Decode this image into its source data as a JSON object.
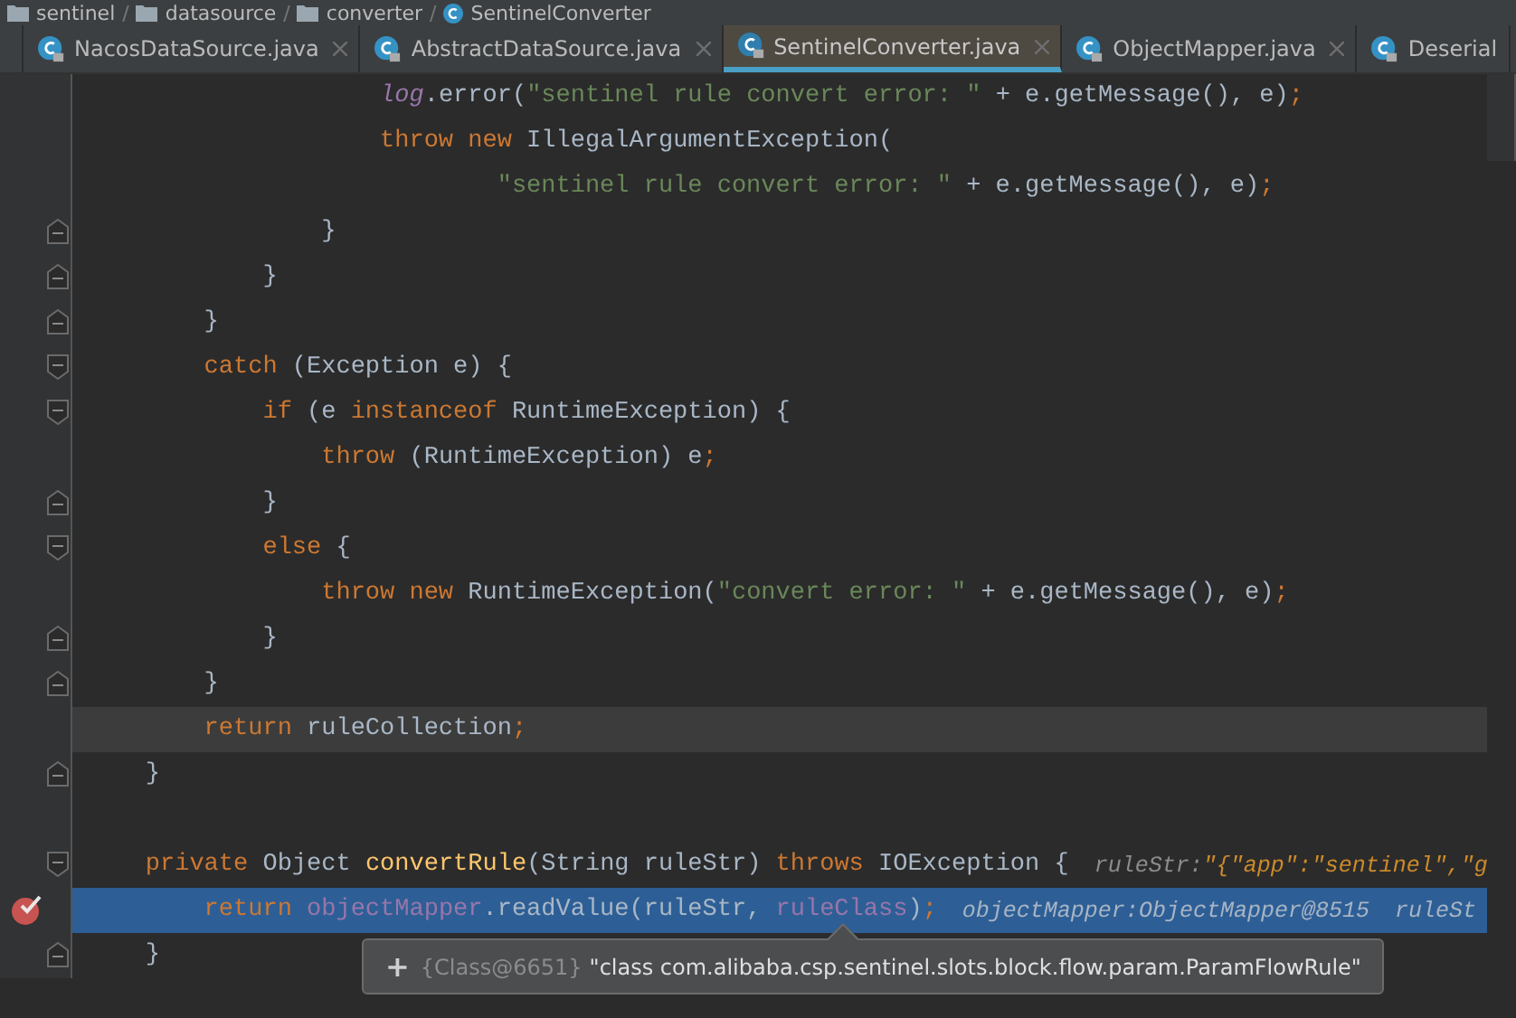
{
  "breadcrumbs": [
    {
      "label": "sentinel",
      "kind": "module",
      "separator": "/"
    },
    {
      "label": "datasource",
      "kind": "folder",
      "separator": "/"
    },
    {
      "label": "converter",
      "kind": "folder",
      "separator": "/"
    },
    {
      "label": "SentinelConverter",
      "kind": "class"
    }
  ],
  "tabs": [
    {
      "label": "NacosDataSource.java",
      "selected": false
    },
    {
      "label": "AbstractDataSource.java",
      "selected": false
    },
    {
      "label": "SentinelConverter.java",
      "selected": true
    },
    {
      "label": "ObjectMapper.java",
      "selected": false
    },
    {
      "label": "Deserial",
      "selected": false
    }
  ],
  "lines": [
    {
      "current": false,
      "selected": false,
      "breakpoint": false,
      "tokens": [
        {
          "kind": "static",
          "text": "                    log"
        },
        {
          "kind": "plain",
          "text": ".error("
        },
        {
          "kind": "string",
          "text": "\"sentinel rule convert error: \""
        },
        {
          "kind": "plain",
          "text": " + e.getMessage(), e)"
        },
        {
          "kind": "punct",
          "text": ";"
        }
      ]
    },
    {
      "current": false,
      "selected": false,
      "breakpoint": false,
      "tokens": [
        {
          "kind": "keyword",
          "text": "                    throw new"
        },
        {
          "kind": "plain",
          "text": " IllegalArgumentException("
        }
      ]
    },
    {
      "current": false,
      "selected": false,
      "breakpoint": false,
      "tokens": [
        {
          "kind": "string",
          "text": "                            \"sentinel rule convert error: \""
        },
        {
          "kind": "plain",
          "text": " + e.getMessage(), e)"
        },
        {
          "kind": "punct",
          "text": ";"
        }
      ]
    },
    {
      "fold": {
        "kind": "end"
      },
      "current": false,
      "selected": false,
      "breakpoint": false,
      "tokens": [
        {
          "kind": "plain",
          "text": "                }"
        }
      ]
    },
    {
      "fold": {
        "kind": "end"
      },
      "current": false,
      "selected": false,
      "breakpoint": false,
      "tokens": [
        {
          "kind": "plain",
          "text": "            }"
        }
      ]
    },
    {
      "fold": {
        "kind": "end"
      },
      "current": false,
      "selected": false,
      "breakpoint": false,
      "tokens": [
        {
          "kind": "plain",
          "text": "        }"
        }
      ]
    },
    {
      "fold": {
        "kind": "start"
      },
      "current": false,
      "selected": false,
      "breakpoint": false,
      "tokens": [
        {
          "kind": "keyword",
          "text": "        catch"
        },
        {
          "kind": "plain",
          "text": " (Exception e) {"
        }
      ]
    },
    {
      "fold": {
        "kind": "start"
      },
      "current": false,
      "selected": false,
      "breakpoint": false,
      "tokens": [
        {
          "kind": "keyword",
          "text": "            if"
        },
        {
          "kind": "plain",
          "text": " (e "
        },
        {
          "kind": "keyword",
          "text": "instanceof"
        },
        {
          "kind": "plain",
          "text": " RuntimeException) {"
        }
      ]
    },
    {
      "current": false,
      "selected": false,
      "breakpoint": false,
      "tokens": [
        {
          "kind": "keyword",
          "text": "                throw"
        },
        {
          "kind": "plain",
          "text": " (RuntimeException) e"
        },
        {
          "kind": "punct",
          "text": ";"
        }
      ]
    },
    {
      "fold": {
        "kind": "end"
      },
      "current": false,
      "selected": false,
      "breakpoint": false,
      "tokens": [
        {
          "kind": "plain",
          "text": "            }"
        }
      ]
    },
    {
      "fold": {
        "kind": "start"
      },
      "current": false,
      "selected": false,
      "breakpoint": false,
      "tokens": [
        {
          "kind": "keyword",
          "text": "            else"
        },
        {
          "kind": "plain",
          "text": " {"
        }
      ]
    },
    {
      "current": false,
      "selected": false,
      "breakpoint": false,
      "tokens": [
        {
          "kind": "keyword",
          "text": "                throw new"
        },
        {
          "kind": "plain",
          "text": " RuntimeException("
        },
        {
          "kind": "string",
          "text": "\"convert error: \""
        },
        {
          "kind": "plain",
          "text": " + e.getMessage(), e)"
        },
        {
          "kind": "punct",
          "text": ";"
        }
      ]
    },
    {
      "fold": {
        "kind": "end"
      },
      "current": false,
      "selected": false,
      "breakpoint": false,
      "tokens": [
        {
          "kind": "plain",
          "text": "            }"
        }
      ]
    },
    {
      "fold": {
        "kind": "end"
      },
      "current": false,
      "selected": false,
      "breakpoint": false,
      "tokens": [
        {
          "kind": "plain",
          "text": "        }"
        }
      ]
    },
    {
      "current": true,
      "selected": false,
      "breakpoint": false,
      "tokens": [
        {
          "kind": "keyword",
          "text": "        return"
        },
        {
          "kind": "plain",
          "text": " ruleCollection"
        },
        {
          "kind": "punct",
          "text": ";"
        }
      ]
    },
    {
      "fold": {
        "kind": "end"
      },
      "current": false,
      "selected": false,
      "breakpoint": false,
      "tokens": [
        {
          "kind": "plain",
          "text": "    }"
        }
      ]
    },
    {
      "current": false,
      "selected": false,
      "breakpoint": false
    },
    {
      "fold": {
        "kind": "start"
      },
      "current": false,
      "selected": false,
      "breakpoint": false,
      "tokens": [
        {
          "kind": "keyword",
          "text": "    private"
        },
        {
          "kind": "plain",
          "text": " Object "
        },
        {
          "kind": "method",
          "text": "convertRule"
        },
        {
          "kind": "plain",
          "text": "(String ruleStr) "
        },
        {
          "kind": "keyword",
          "text": "throws"
        },
        {
          "kind": "plain",
          "text": " IOException {"
        }
      ],
      "hints": [
        {
          "label": "ruleStr:",
          "value": "\"{\"app\":\"sentinel\",\"g",
          "kind": "string"
        }
      ]
    },
    {
      "current": false,
      "selected": true,
      "breakpoint": true,
      "tokens": [
        {
          "kind": "keyword",
          "text": "        return "
        },
        {
          "kind": "field",
          "text": "objectMapper"
        },
        {
          "kind": "plain",
          "text": ".readValue(ruleStr, "
        },
        {
          "kind": "field",
          "text": "ruleClass"
        },
        {
          "kind": "plain",
          "text": ")"
        },
        {
          "kind": "punct",
          "text": ";"
        }
      ],
      "hints": [
        {
          "label": "objectMapper:",
          "value": "ObjectMapper@8515",
          "kind": "object"
        },
        {
          "label": "ruleSt"
        }
      ]
    },
    {
      "fold": {
        "kind": "end"
      },
      "current": false,
      "selected": false,
      "breakpoint": false,
      "tokens": [
        {
          "kind": "plain",
          "text": "    }"
        }
      ]
    }
  ],
  "tooltip": {
    "expand": "+",
    "type": "{Class@6651}",
    "value": "\"class com.alibaba.csp.sentinel.slots.block.flow.param.ParamFlowRule\""
  }
}
